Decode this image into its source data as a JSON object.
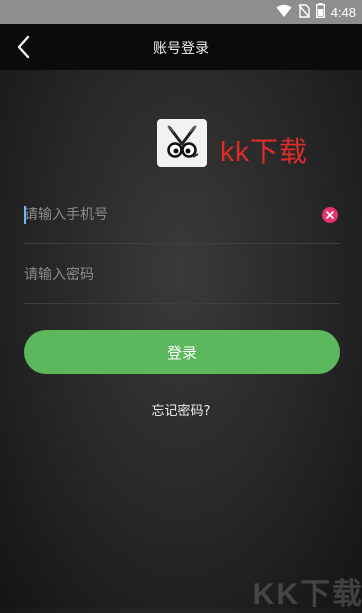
{
  "status_bar": {
    "time": "4:48",
    "icons": [
      "wifi-icon",
      "no-sim-icon",
      "battery-icon"
    ]
  },
  "nav": {
    "title": "账号登录",
    "back_icon": "chevron-left-icon"
  },
  "logo": {
    "icon": "app-logo-icon",
    "watermark_text": "kk下载"
  },
  "form": {
    "phone_placeholder": "请输入手机号",
    "password_placeholder": "请输入密码",
    "login_label": "登录",
    "forgot_label": "忘记密码?"
  },
  "watermark": {
    "corner_text": "KK下载"
  },
  "colors": {
    "accent_green": "#5cb85c",
    "clear_pink": "#e2336b",
    "watermark_red": "#e02b2b"
  }
}
